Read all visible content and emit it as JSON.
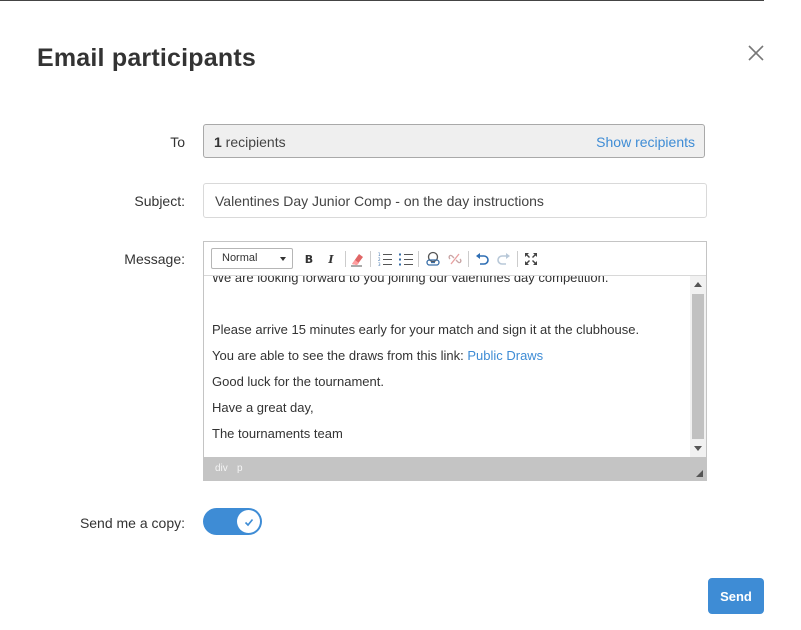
{
  "dialog": {
    "title": "Email participants",
    "close_icon": "close-icon"
  },
  "form": {
    "to_label": "To",
    "recipients_count": "1",
    "recipients_suffix": " recipients",
    "show_recipients": "Show recipients",
    "subject_label": "Subject:",
    "subject_value": "Valentines Day Junior Comp - on the day instructions",
    "message_label": "Message:",
    "copy_label": "Send me a copy:",
    "copy_enabled": true
  },
  "editor": {
    "format_value": "Normal",
    "toolbar_icons": [
      "bold-icon",
      "italic-icon",
      "remove-format-icon",
      "numbered-list-icon",
      "bullet-list-icon",
      "link-icon",
      "unlink-icon",
      "undo-icon",
      "redo-icon",
      "maximize-icon"
    ],
    "bold_label": "B",
    "italic_label": "I",
    "lines": {
      "l1": "We are looking forward to you joining our valentines day competition.",
      "l2": "Please arrive 15 minutes early for your match and sign it at the clubhouse.",
      "l3_prefix": "You are able to see the draws from this link: ",
      "l3_link": "Public Draws",
      "l4": "Good luck for the tournament.",
      "l5": "Have a great day,",
      "l6": "The tournaments team"
    },
    "path": [
      "div",
      "p"
    ]
  },
  "actions": {
    "send_label": "Send"
  },
  "colors": {
    "accent": "#3e8cd5",
    "text": "#333333",
    "status_bar": "#c4c4c4"
  }
}
